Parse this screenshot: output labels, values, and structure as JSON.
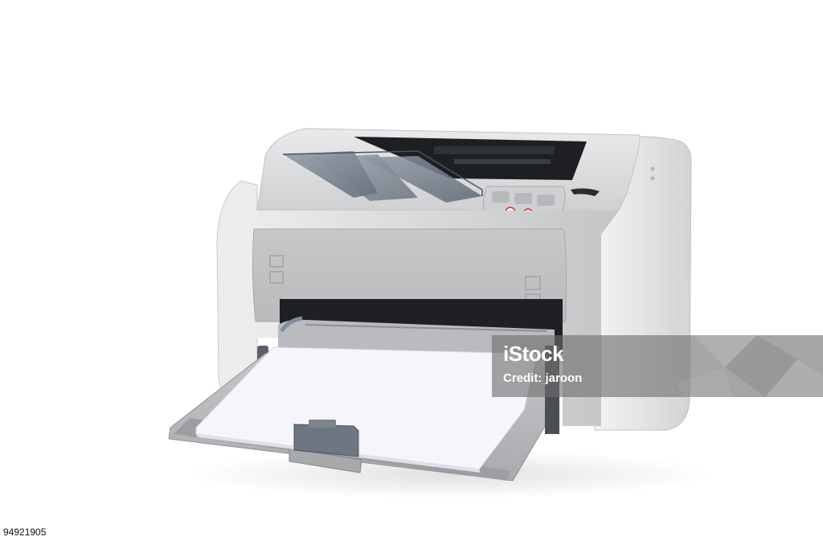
{
  "image": {
    "subject": "laser-printer",
    "background_color": "#ffffff",
    "printer_body_color": "#d9dadb",
    "paper_color": "#f4f4fb"
  },
  "watermark": {
    "logo_text": "iStock",
    "credit_label": "Credit: jaroon"
  },
  "image_id": "94921905"
}
